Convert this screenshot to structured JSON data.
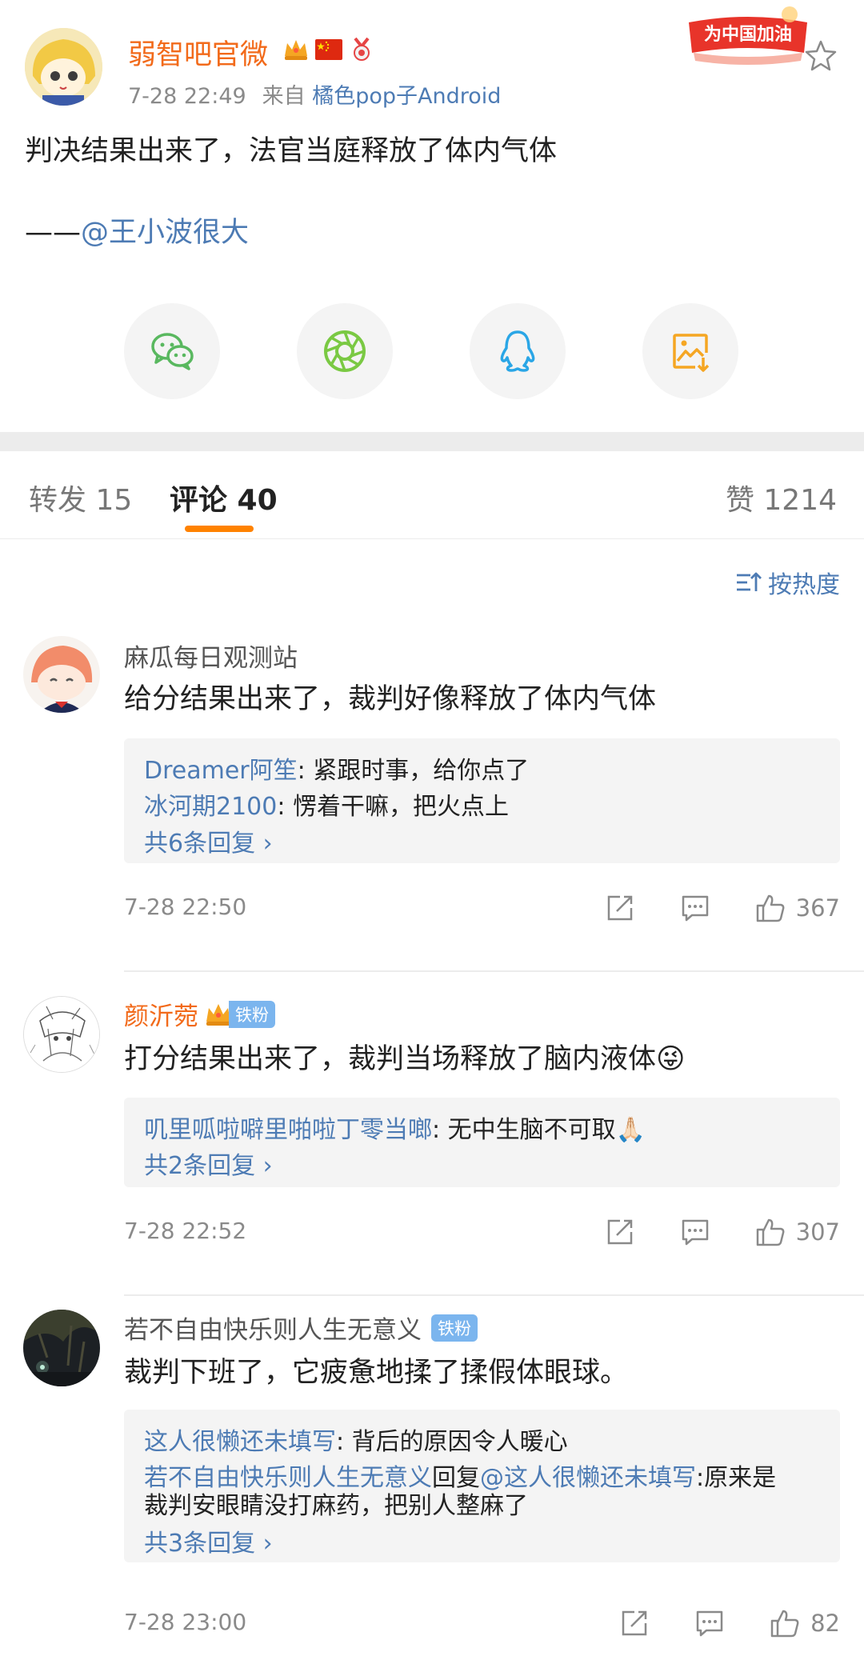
{
  "post": {
    "author": "弱智吧官微",
    "time": "7-28 22:49",
    "from_label": "来自",
    "source": "橘色pop子Android",
    "cheer_banner": "为中国加油",
    "text": "判决结果出来了，法官当庭释放了体内气体",
    "credit_prefix": "——",
    "credit_mention": "@王小波很大"
  },
  "share": [
    {
      "name": "wechat-share-button",
      "icon": "wechat-icon",
      "color": "#59b85f"
    },
    {
      "name": "moments-share-button",
      "icon": "moments-aperture-icon",
      "color": "#7ac943"
    },
    {
      "name": "qq-share-button",
      "icon": "qq-penguin-icon",
      "color": "#2aa6e6"
    },
    {
      "name": "save-image-button",
      "icon": "save-image-icon",
      "color": "#f5a623"
    }
  ],
  "tabs": {
    "repost": "转发 15",
    "comment": "评论 40",
    "like": "赞 1214"
  },
  "sort_label": "按热度",
  "fan_badge": "铁粉",
  "comments": [
    {
      "user": "麻瓜每日观测站",
      "text": "给分结果出来了，裁判好像释放了体内气体",
      "replies": [
        {
          "name": "Dreamer阿笙",
          "text": ": 紧跟时事，给你点了"
        },
        {
          "name": "冰河期2100",
          "text": ": 愣着干嘛，把火点上"
        }
      ],
      "more": "共6条回复 ›",
      "time": "7-28 22:50",
      "likes": "367"
    },
    {
      "user": "颜沂菀",
      "text": "打分结果出来了，裁判当场释放了脑内液体😜",
      "replies": [
        {
          "name": "叽里呱啦噼里啪啦丁零当啷",
          "text": ": 无中生脑不可取🙏🏻"
        }
      ],
      "more": "共2条回复 ›",
      "time": "7-28 22:52",
      "likes": "307"
    },
    {
      "user": "若不自由快乐则人生无意义",
      "text": "裁判下班了，它疲惫地揉了揉假体眼球。",
      "replies": [
        {
          "name": "这人很懒还未填写",
          "text": ": 背后的原因令人暖心"
        },
        {
          "name": "若不自由快乐则人生无意义",
          "mid": "回复",
          "mention": "@这人很懒还未填写",
          "text": ":原来是",
          "text2": "裁判安眼睛没打麻药，把别人整麻了"
        }
      ],
      "more": "共3条回复 ›",
      "time": "7-28 23:00",
      "likes": "82"
    }
  ]
}
